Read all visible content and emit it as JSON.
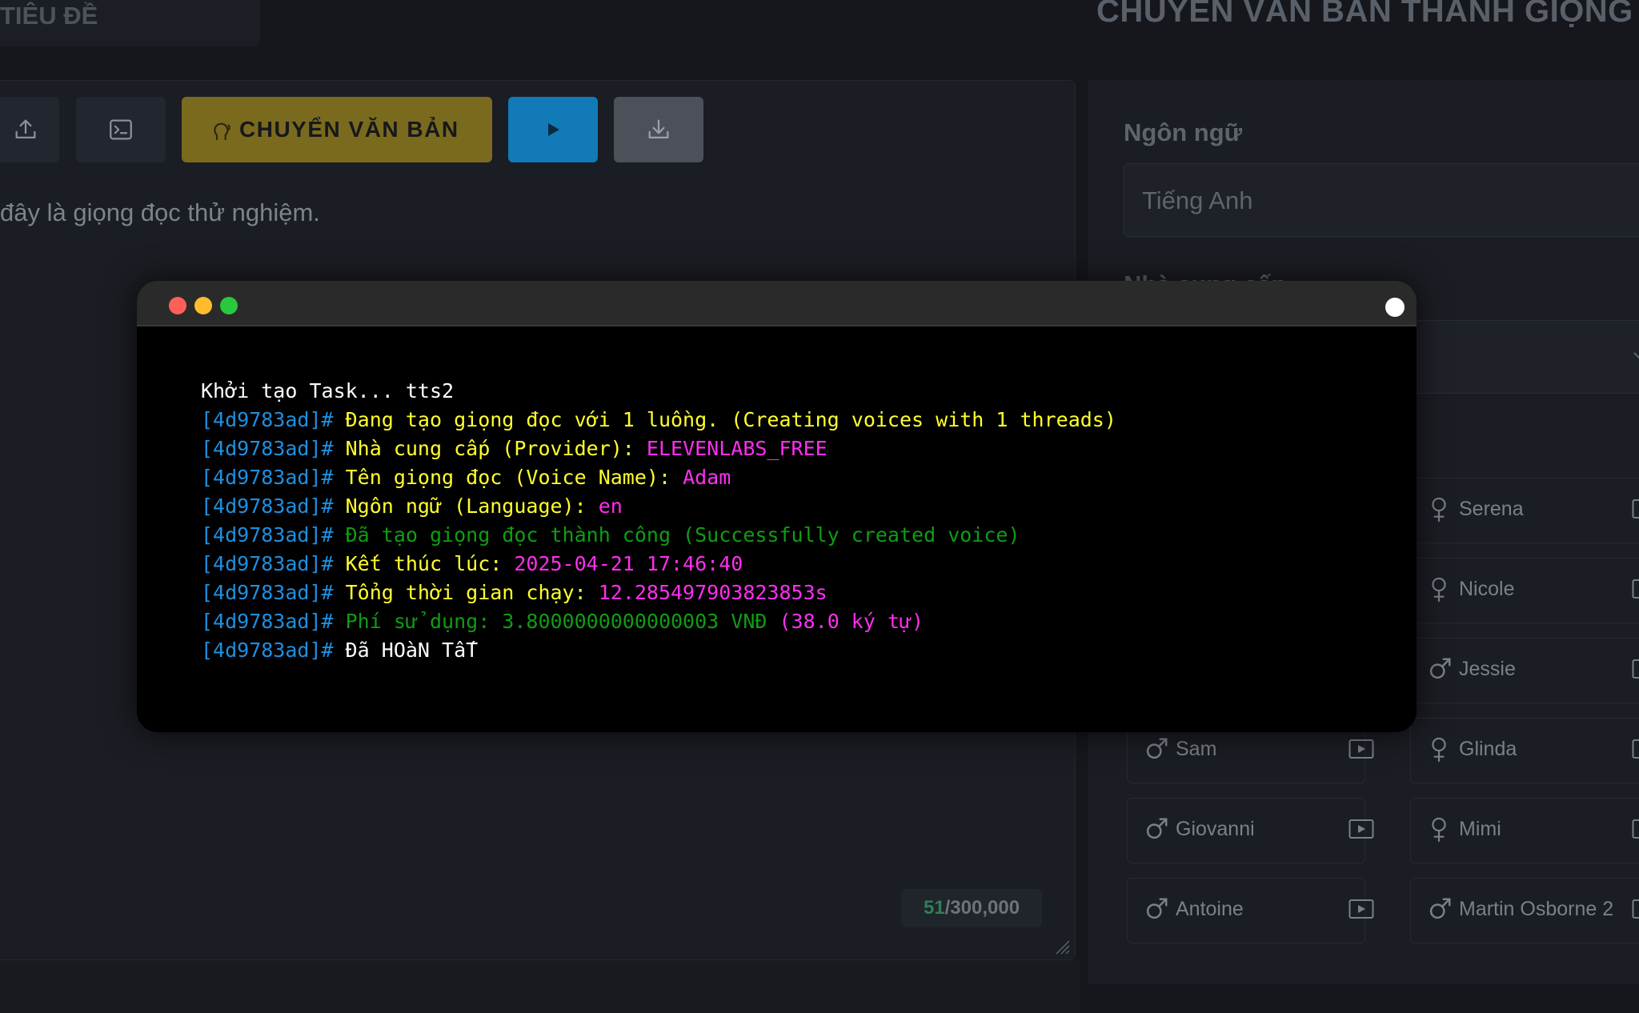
{
  "header": {
    "title_tab": "TIÊU ĐỀ",
    "app_title": "CHUYỂN VĂN BẢN THÀNH GIỌNG ĐỌC"
  },
  "toolbar": {
    "convert_label": "CHUYỂN VĂN BẢN"
  },
  "editor": {
    "text": "đây là giọng đọc thử nghiệm.",
    "char_count": "51",
    "char_limit": "/300,000"
  },
  "settings": {
    "language_label": "Ngôn ngữ",
    "language_value": "Tiếng Anh",
    "voice_label": "Nhà cung cấp"
  },
  "voices": [
    {
      "name": "Serena",
      "gender": "female"
    },
    {
      "name": "Nicole",
      "gender": "female"
    },
    {
      "name": "Jessie",
      "gender": "male"
    },
    {
      "name": "Sam",
      "gender": "male"
    },
    {
      "name": "Glinda",
      "gender": "female"
    },
    {
      "name": "Giovanni",
      "gender": "male"
    },
    {
      "name": "Mimi",
      "gender": "female"
    },
    {
      "name": "Antoine",
      "gender": "male"
    },
    {
      "name": "Martin Osborne 2",
      "gender": "male"
    }
  ],
  "terminal": {
    "lines": [
      [
        {
          "t": "Khởi tạo Task... tts2",
          "c": "#ffffff"
        }
      ],
      [
        {
          "t": "[4d9783ad]# ",
          "c": "#1e90e0"
        },
        {
          "t": "Đang tạo giọng đọc với 1 luồng. (Creating voices with 1 threads)",
          "c": "#ffff2e"
        }
      ],
      [
        {
          "t": "[4d9783ad]# ",
          "c": "#1e90e0"
        },
        {
          "t": "Nhà cung cấp (Provider): ",
          "c": "#ffff2e"
        },
        {
          "t": "ELEVENLABS_FREE",
          "c": "#ff2ef0"
        }
      ],
      [
        {
          "t": "[4d9783ad]# ",
          "c": "#1e90e0"
        },
        {
          "t": "Tên giọng đọc (Voice Name): ",
          "c": "#ffff2e"
        },
        {
          "t": "Adam",
          "c": "#ff2ef0"
        }
      ],
      [
        {
          "t": "[4d9783ad]# ",
          "c": "#1e90e0"
        },
        {
          "t": "Ngôn ngữ (Language): ",
          "c": "#ffff2e"
        },
        {
          "t": "en",
          "c": "#ff2ef0"
        }
      ],
      [
        {
          "t": "[4d9783ad]# ",
          "c": "#1e90e0"
        },
        {
          "t": "Đã tạo giọng đọc thành công (Successfully created voice)",
          "c": "#0f9d14"
        }
      ],
      [
        {
          "t": "[4d9783ad]# ",
          "c": "#1e90e0"
        },
        {
          "t": "Kết thúc lúc: ",
          "c": "#ffff2e"
        },
        {
          "t": "2025-04-21 17:46:40",
          "c": "#ff2ef0"
        }
      ],
      [
        {
          "t": "[4d9783ad]# ",
          "c": "#1e90e0"
        },
        {
          "t": "Tổng thời gian chạy: ",
          "c": "#ffff2e"
        },
        {
          "t": "12.285497903823853s",
          "c": "#ff2ef0"
        }
      ],
      [
        {
          "t": "[4d9783ad]# ",
          "c": "#1e90e0"
        },
        {
          "t": "Phí sử dụng: 3.8000000000000003 VNĐ ",
          "c": "#0f9d14"
        },
        {
          "t": "(38.0 ký tự)",
          "c": "#ff2ef0"
        }
      ],
      [
        {
          "t": "[4d9783ad]# ",
          "c": "#1e90e0"
        },
        {
          "t": "Đã HOàN TấT",
          "c": "#ffffff"
        }
      ]
    ]
  },
  "colors": {
    "convert_button": "#7a6a1e",
    "play_button": "#117ab7",
    "terminal_bg": "#000000",
    "dot_red": "#ff5f57",
    "dot_yellow": "#febc2e",
    "dot_green": "#28c840"
  },
  "icons": {
    "upload": "upload-icon",
    "console": "terminal-icon",
    "voice": "speaking-head-icon",
    "play": "play-icon",
    "download": "download-icon"
  }
}
